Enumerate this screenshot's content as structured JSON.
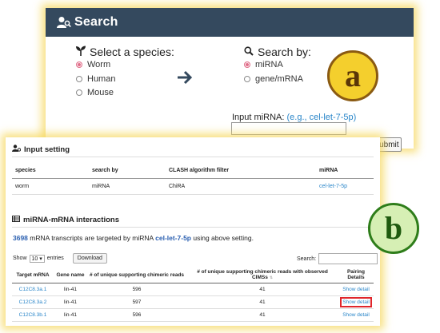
{
  "search_panel": {
    "title": "Search",
    "species": {
      "title": "Select a species:",
      "options": [
        {
          "label": "Worm",
          "checked": true
        },
        {
          "label": "Human",
          "checked": false
        },
        {
          "label": "Mouse",
          "checked": false
        }
      ]
    },
    "search_by": {
      "title": "Search by:",
      "options": [
        {
          "label": "miRNA",
          "checked": true
        },
        {
          "label": "gene/mRNA",
          "checked": false
        }
      ]
    },
    "input_label": "Input miRNA:",
    "input_example": "(e.g., cel-let-7-5p)",
    "input_value": "",
    "submit_label": "Submit",
    "badge": "a"
  },
  "results_panel": {
    "badge": "b",
    "input_setting": {
      "title": "Input setting",
      "headers": [
        "species",
        "search by",
        "CLASH algorithm filter",
        "miRNA"
      ],
      "row": [
        "worm",
        "miRNA",
        "ChiRA",
        "cel-let-7-5p"
      ]
    },
    "interactions": {
      "title": "miRNA-mRNA interactions",
      "summary": {
        "count": "3698",
        "before": " mRNA transcripts are targeted by miRNA ",
        "mirna": "cel-let-7-5p",
        "after": " using above setting."
      },
      "show_label": "Show",
      "entries_value": "10",
      "entries_label": "entries",
      "download_label": "Download",
      "search_label": "Search:",
      "search_value": "",
      "headers": [
        "Target mRNA",
        "Gene name",
        "# of unique supporting chimeric reads",
        "# of unique supporting chimeric reads with observed CIMSs",
        "Pairing Details"
      ],
      "rows": [
        {
          "target": "C12C8.3a.1",
          "gene": "lin-41",
          "reads": "596",
          "cims": "41",
          "detail": "Show detail"
        },
        {
          "target": "C12C8.3a.2",
          "gene": "lin-41",
          "reads": "597",
          "cims": "41",
          "detail": "Show detail"
        },
        {
          "target": "C12C8.3b.1",
          "gene": "lin-41",
          "reads": "596",
          "cims": "41",
          "detail": "Show detail"
        }
      ]
    }
  },
  "colors": {
    "header_bg": "#34495e",
    "link": "#2a86c9",
    "highlight": "#e0262b",
    "glow": "#f5d75a",
    "badge_a": "#f4cf2d",
    "badge_b": "#d6efb4"
  },
  "icons": [
    "user-search-icon",
    "seedling-icon",
    "magnifier-icon",
    "arrow-right-icon",
    "user-gear-icon",
    "table-icon"
  ]
}
